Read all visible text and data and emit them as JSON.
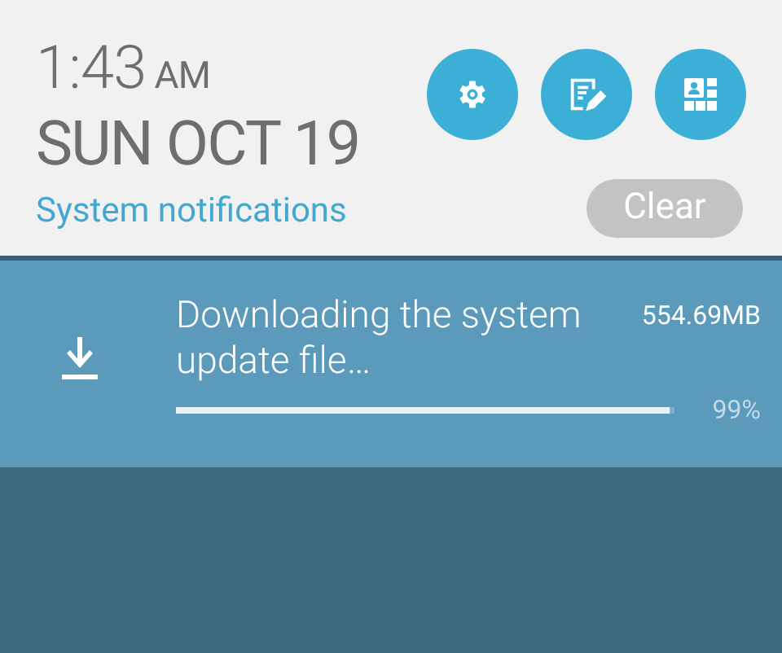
{
  "header": {
    "time": "1:43",
    "meridiem": "AM",
    "date": "SUN OCT 19",
    "section_label": "System notifications",
    "quick_buttons": [
      {
        "kind": "settings"
      },
      {
        "kind": "notes"
      },
      {
        "kind": "apps"
      }
    ],
    "clear_button": "Clear"
  },
  "notifications": [
    {
      "kind": "download",
      "title": "Downloading the system update file…",
      "size": "554.69MB",
      "level": 0.99,
      "percent": "99%"
    }
  ]
}
